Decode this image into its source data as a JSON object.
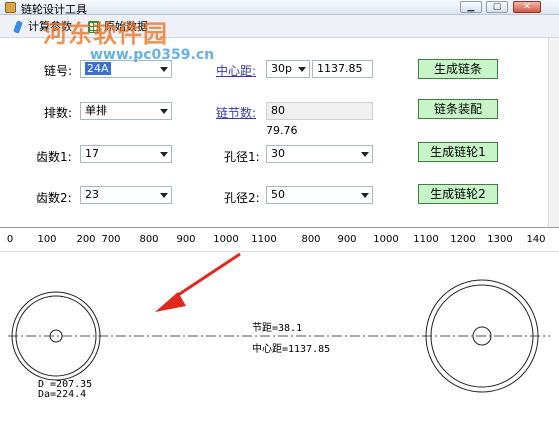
{
  "window": {
    "title": "链轮设计工具",
    "minimize": "▁",
    "maximize": "▢",
    "close": "✕"
  },
  "toolbar": {
    "tool1_label": "计算参数",
    "tool2_label": "原始数据"
  },
  "watermark": {
    "brand": "河东软件园",
    "url": "www.pc0359.cn"
  },
  "form": {
    "chain_no_label": "链号:",
    "chain_no_value": "24A",
    "rows_label": "排数:",
    "rows_value": "单排",
    "teeth1_label": "齿数1:",
    "teeth1_value": "17",
    "teeth2_label": "齿数2:",
    "teeth2_value": "23",
    "center_label": "中心距:",
    "center_unit": "30p",
    "center_value": "1137.85",
    "links_label": "链节数:",
    "links_value": "80",
    "links_calc": "79.76",
    "bore1_label": "孔径1:",
    "bore1_value": "30",
    "bore2_label": "孔径2:",
    "bore2_value": "50"
  },
  "buttons": {
    "gen_chain": "生成链条",
    "chain_assembly": "链条装配",
    "gen_sprocket1": "生成链轮1",
    "gen_sprocket2": "生成链轮2"
  },
  "ruler": {
    "ticks": [
      "0",
      "100",
      "200",
      "700",
      "800",
      "900",
      "1000",
      "1100",
      "800",
      "900",
      "1000",
      "1100",
      "1200",
      "1300",
      "140"
    ]
  },
  "drawing": {
    "pitch_text": "节距=38.1",
    "center_text": "中心距=1137.85",
    "d_text": "D =207.35",
    "da_text": "Da=224.4",
    "accent_color": "#e0281e"
  }
}
